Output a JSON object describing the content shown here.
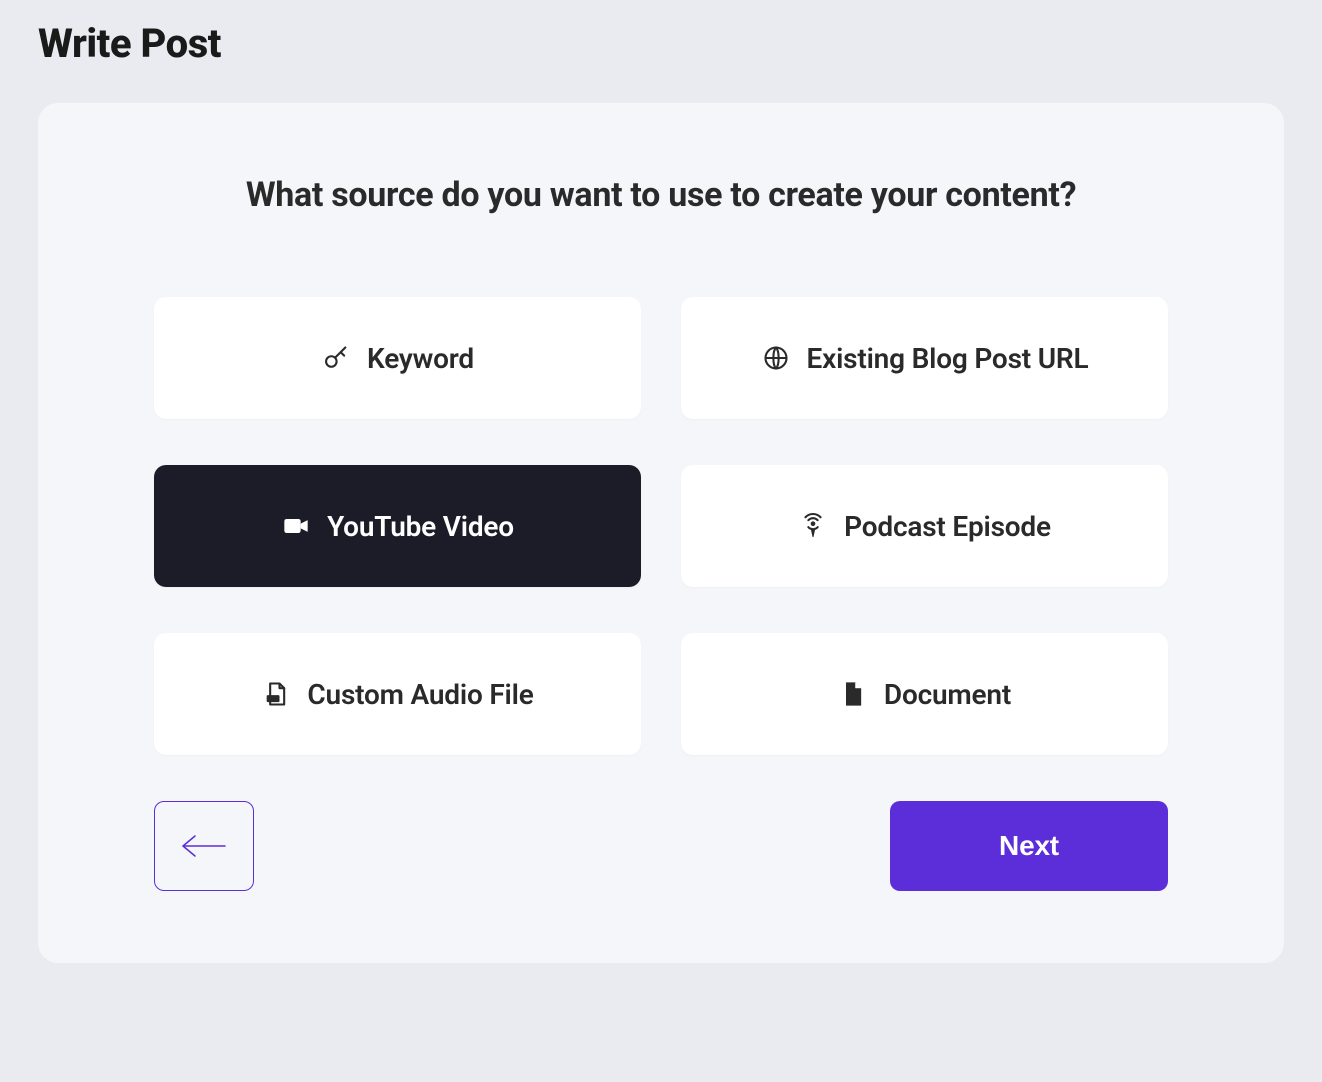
{
  "page_title": "Write Post",
  "prompt": "What source do you want to use to create your content?",
  "options": [
    {
      "id": "keyword",
      "label": "Keyword",
      "icon": "key-icon",
      "selected": false
    },
    {
      "id": "blog-url",
      "label": "Existing Blog Post URL",
      "icon": "globe-icon",
      "selected": false
    },
    {
      "id": "youtube",
      "label": "YouTube Video",
      "icon": "video-icon",
      "selected": true
    },
    {
      "id": "podcast",
      "label": "Podcast Episode",
      "icon": "podcast-icon",
      "selected": false
    },
    {
      "id": "audio-file",
      "label": "Custom Audio File",
      "icon": "audio-file-icon",
      "selected": false
    },
    {
      "id": "document",
      "label": "Document",
      "icon": "document-icon",
      "selected": false
    }
  ],
  "buttons": {
    "back_aria": "Back",
    "next_label": "Next"
  },
  "colors": {
    "accent": "#5b2ed9",
    "dark": "#1c1c28"
  }
}
